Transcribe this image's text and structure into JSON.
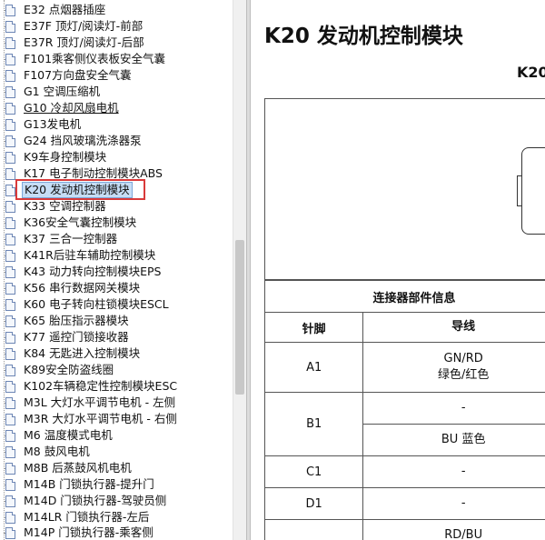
{
  "sidebar": {
    "items": [
      {
        "label": "E32 点烟器插座"
      },
      {
        "label": "E37F 顶灯/阅读灯-前部"
      },
      {
        "label": "E37R 顶灯/阅读灯-后部"
      },
      {
        "label": "F101乘客侧仪表板安全气囊"
      },
      {
        "label": "F107方向盘安全气囊"
      },
      {
        "label": "G1 空调压缩机"
      },
      {
        "label": "G10 冷却风扇电机"
      },
      {
        "label": "G13发电机"
      },
      {
        "label": "G24 挡风玻璃洗涤器泵"
      },
      {
        "label": "K9车身控制模块"
      },
      {
        "label": "K17 电子制动控制模块ABS"
      },
      {
        "label": "K20 发动机控制模块"
      },
      {
        "label": "K33 空调控制器"
      },
      {
        "label": "K36安全气囊控制模块"
      },
      {
        "label": "K37 三合一控制器"
      },
      {
        "label": "K41R后驻车辅助控制模块"
      },
      {
        "label": "K43 动力转向控制模块EPS"
      },
      {
        "label": "K56 串行数据网关模块"
      },
      {
        "label": "K60 电子转向柱锁模块ESCL"
      },
      {
        "label": "K65 胎压指示器模块"
      },
      {
        "label": "K77 遥控门锁接收器"
      },
      {
        "label": "K84 无匙进入控制模块"
      },
      {
        "label": "K89安全防盗线圈"
      },
      {
        "label": "K102车辆稳定性控制模块ESC"
      },
      {
        "label": "M3L 大灯水平调节电机 - 左侧"
      },
      {
        "label": "M3R 大灯水平调节电机 - 右侧"
      },
      {
        "label": "M6 温度模式电机"
      },
      {
        "label": "M8 鼓风电机"
      },
      {
        "label": "M8B 后蒸鼓风机电机"
      },
      {
        "label": "M14B 门锁执行器-提升门"
      },
      {
        "label": "M14D 门锁执行器-驾驶员侧"
      },
      {
        "label": "M14LR 门锁执行器-左后"
      },
      {
        "label": "M14P 门锁执行器-乘客侧"
      }
    ]
  },
  "content": {
    "title": "K20 发动机控制模块",
    "subtitle": "K20",
    "connector_info_label": "连接器部件信息",
    "col_pin": "针脚",
    "col_wire": "导线",
    "rows": {
      "a1": {
        "pin": "A1",
        "wire": "GN/RD",
        "wire_cn": "绿色/红色"
      },
      "b1": {
        "pin": "B1",
        "wire1": "-",
        "wire2": "BU 蓝色"
      },
      "c1": {
        "pin": "C1",
        "wire": "-"
      },
      "d1": {
        "pin": "D1",
        "wire": "-"
      },
      "next": {
        "wire": "RD/BU"
      }
    }
  }
}
